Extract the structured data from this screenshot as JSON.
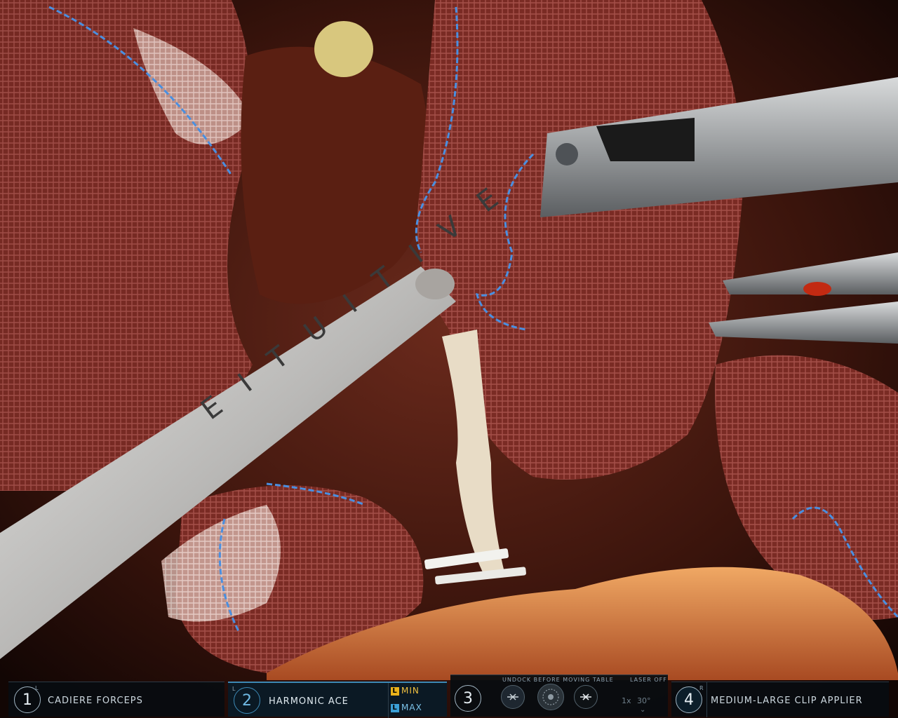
{
  "hud": {
    "arms": [
      {
        "number": "1",
        "tool": "CADIERE FORCEPS",
        "corner": "L"
      },
      {
        "number": "2",
        "tool": "HARMONIC ACE",
        "corner": "L",
        "energy_min": "MIN",
        "energy_max": "MAX",
        "min_badge": "L",
        "max_badge": "L"
      },
      {
        "number": "3",
        "status": "UNDOCK BEFORE MOVING TABLE",
        "laser": "LASER OFF",
        "zoom": "1x",
        "angle": "30°"
      },
      {
        "number": "4",
        "tool": "MEDIUM-LARGE CLIP APPLIER",
        "corner": "R"
      }
    ]
  },
  "colors": {
    "active_accent": "#3d89b5",
    "min_badge": "#e9b21a",
    "max_badge": "#3b9fd6"
  }
}
